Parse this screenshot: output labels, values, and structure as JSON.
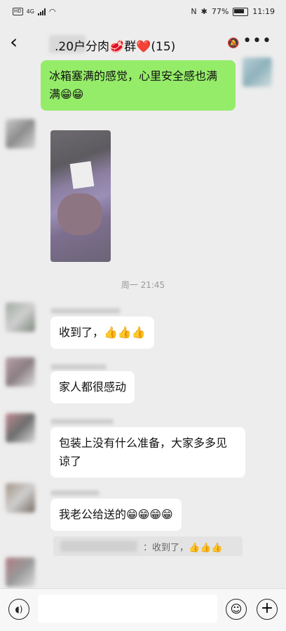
{
  "status_bar": {
    "network": "HD",
    "network_gen": "4G",
    "battery": "77%",
    "time": "11:19"
  },
  "header": {
    "back_icon": "chevron-left-icon",
    "title": ".20户分肉🥩群❤️(15)",
    "title_prefix_icon": "heart-icon",
    "mute_icon": "bell-off-icon",
    "more_icon": "more-dots-icon"
  },
  "messages": {
    "m1": "冰箱塞满的感觉，心里安全感也满满😁😁",
    "m2": "收到了，👍👍👍",
    "m3": "家人都很感动",
    "m4": "包装上没有什么准备，大家多多见谅了",
    "m5": "我老公给送的😁😁😁😁",
    "quote": "：收到了，👍👍👍"
  },
  "timestamp": "周一 21:45",
  "bottom_bar": {
    "voice_icon": "voice-icon",
    "emoji_icon": "emoji-icon",
    "plus_icon": "plus-icon"
  }
}
